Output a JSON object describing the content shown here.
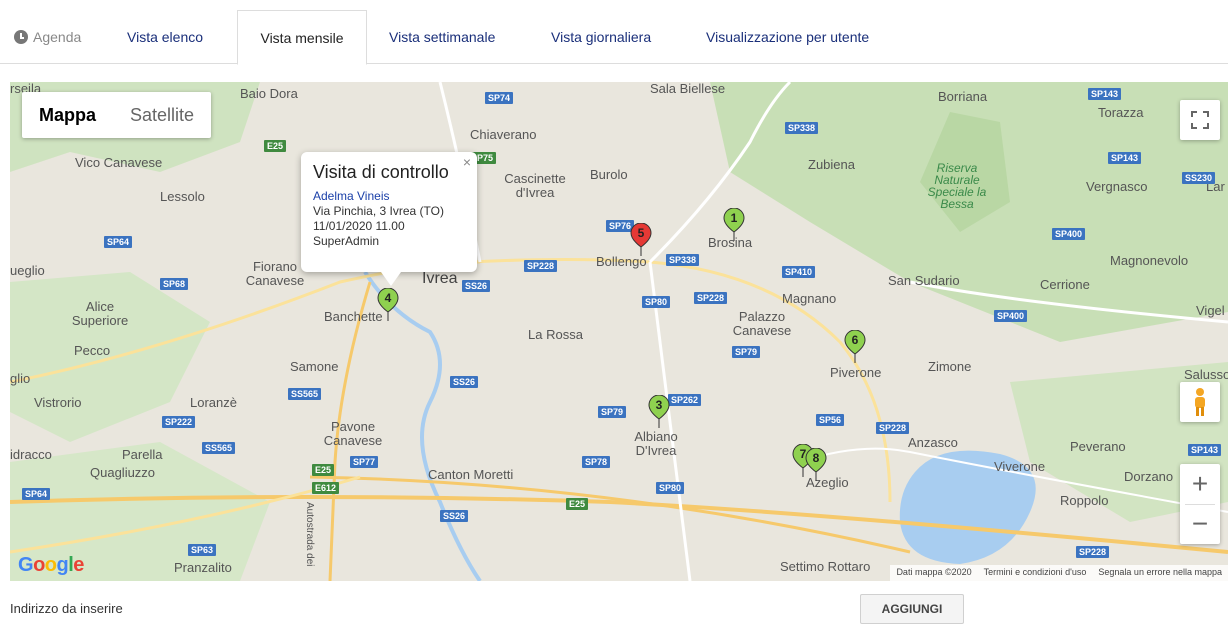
{
  "tabs": {
    "agenda": "Agenda",
    "items": [
      "Vista elenco",
      "Vista mensile",
      "Vista settimanale",
      "Vista giornaliera",
      "Visualizzazione per utente"
    ],
    "active": "Vista mensile"
  },
  "map": {
    "type_map": "Mappa",
    "type_satellite": "Satellite",
    "zoom_in": "+",
    "zoom_out": "−",
    "google": "Google",
    "attribution": [
      "Dati mappa ©2020",
      "Termini e condizioni d'uso",
      "Segnala un errore nella mappa"
    ],
    "places": [
      "Baio Dora",
      "Chiaverano",
      "Vico Canavese",
      "Lessolo",
      "Fiorano Canavese",
      "Ivrea",
      "Banchette",
      "Cascinette d'Ivrea",
      "Burolo",
      "Bollengo",
      "Brosina",
      "Zubiena",
      "Borriana",
      "Torazza",
      "Vergnasco",
      "Magnonevolo",
      "Cerrione",
      "San Sudario",
      "Magnano",
      "Palazzo Canavese",
      "Piverone",
      "Zimone",
      "La Rossa",
      "Alice Superiore",
      "Pecco",
      "Samone",
      "Vistrorio",
      "Loranzè",
      "Pavone Canavese",
      "Parella",
      "Quagliuzzo",
      "Canton Moretti",
      "Albiano D'Ivrea",
      "Azeglio",
      "Anzasco",
      "Viverone",
      "Peverano",
      "Dorzano",
      "Roppolo",
      "Pranzalito",
      "Settimo Rottaro",
      "Sala Biellese",
      "Riserva Naturale Speciale la Bessa",
      "Vigel",
      "Salusso",
      "ueglio",
      "glio",
      "idracco",
      "rseila",
      "Lar",
      "Autostrada dei"
    ],
    "roads": [
      "SP74",
      "SP338",
      "SP143",
      "SS230",
      "E25",
      "SS26",
      "SP76",
      "SP338",
      "SP228",
      "SP80",
      "SP228",
      "SP410",
      "SP400",
      "SP400",
      "SP143",
      "SP64",
      "SP68",
      "SP79",
      "SS26",
      "SP262",
      "SS565",
      "SP79",
      "SP222",
      "SS565",
      "SP77",
      "SP56",
      "SP228",
      "SP143",
      "SP78",
      "E25",
      "E612",
      "SP80",
      "E25",
      "SS26",
      "SP64",
      "SP63",
      "SP228",
      "SP75"
    ]
  },
  "popup": {
    "close": "×",
    "title": "Visita di controllo",
    "name": "Adelma Vineis",
    "address": "Via Pinchia, 3 Ivrea (TO)",
    "datetime": "11/01/2020 11.00",
    "user": "SuperAdmin"
  },
  "markers": [
    {
      "label": "1",
      "color": "#8fd14f"
    },
    {
      "label": "5",
      "color": "#e53935"
    },
    {
      "label": "4",
      "color": "#8fd14f"
    },
    {
      "label": "6",
      "color": "#8fd14f"
    },
    {
      "label": "3",
      "color": "#8fd14f"
    },
    {
      "label": "7",
      "color": "#8fd14f"
    },
    {
      "label": "8",
      "color": "#8fd14f"
    }
  ],
  "form": {
    "address_label": "Indirizzo da inserire",
    "add_button": "AGGIUNGI"
  }
}
